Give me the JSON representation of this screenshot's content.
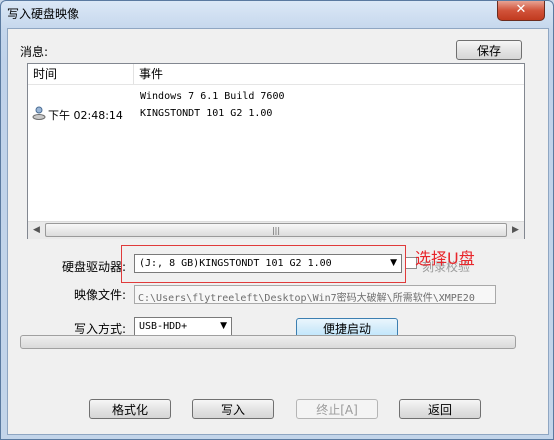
{
  "window": {
    "title": "写入硬盘映像",
    "close_glyph": "✕"
  },
  "messages": {
    "label": "消息:",
    "save_label": "保存",
    "columns": [
      "时间",
      "事件"
    ],
    "rows": [
      {
        "time": "",
        "event": "Windows 7 6.1 Build 7600"
      },
      {
        "time": "下午 02:48:14",
        "event": "KINGSTONDT 101 G2       1.00"
      }
    ]
  },
  "drive": {
    "label": "硬盘驱动器:",
    "value": "(J:, 8 GB)KINGSTONDT 101 G2       1.00"
  },
  "verify": {
    "label": "刻录校验"
  },
  "image_file": {
    "label": "映像文件:",
    "value": "C:\\Users\\flytreeleft\\Desktop\\Win7密码大破解\\所需软件\\XMPE20"
  },
  "write_method": {
    "label": "写入方式:",
    "value": "USB-HDD+"
  },
  "quick_start_label": "便捷启动",
  "buttons": {
    "format": "格式化",
    "write": "写入",
    "abort": "终止[A]",
    "back": "返回"
  },
  "annotation": {
    "text": "选择U盘",
    "color": "#e8262b"
  },
  "icons": {
    "row_icon": "user-disk-icon",
    "dropdown": "chevron-down-icon"
  }
}
